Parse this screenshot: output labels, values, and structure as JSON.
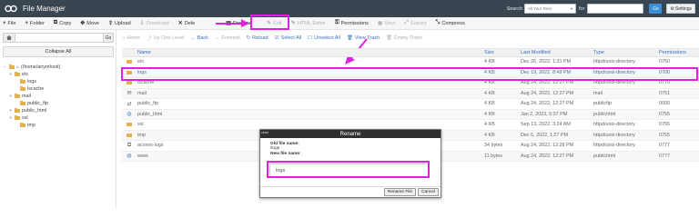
{
  "titlebar": {
    "title": "File Manager",
    "search_label": "Search",
    "search_scope": "All Your Files",
    "for_label": "for",
    "go_label": "Go",
    "settings_label": "Settings"
  },
  "toolbar": {
    "items": [
      {
        "label": "File",
        "icon": "plus-icon"
      },
      {
        "label": "Folder",
        "icon": "plus-icon"
      },
      {
        "label": "Copy",
        "icon": "copy-icon"
      },
      {
        "label": "Move",
        "icon": "move-icon"
      },
      {
        "label": "Upload",
        "icon": "upload-icon"
      },
      {
        "label": "Download",
        "icon": "download-icon"
      },
      {
        "label": "Dele",
        "icon": "close-icon"
      },
      {
        "label": "Rename",
        "icon": "file-icon"
      },
      {
        "label": "Edit",
        "icon": "pencil-icon"
      },
      {
        "label": "HTML Editor",
        "icon": "pencil-icon"
      },
      {
        "label": "Permissions",
        "icon": "key-icon"
      },
      {
        "label": "View",
        "icon": "eye-icon"
      },
      {
        "label": "Extract",
        "icon": "extract-icon"
      },
      {
        "label": "Compress",
        "icon": "compress-icon"
      }
    ]
  },
  "left_pane": {
    "go_label": "Go",
    "collapse_label": "Collapse All",
    "tree": [
      {
        "label": "(/home/anymhost)",
        "level": 0,
        "pm": "−",
        "home": true
      },
      {
        "label": "etc",
        "level": 1,
        "pm": "+"
      },
      {
        "label": "logs",
        "level": 2,
        "pm": ""
      },
      {
        "label": "lscache",
        "level": 2,
        "pm": ""
      },
      {
        "label": "mail",
        "level": 1,
        "pm": "+"
      },
      {
        "label": "public_ftp",
        "level": 2,
        "pm": ""
      },
      {
        "label": "public_html",
        "level": 1,
        "pm": "+"
      },
      {
        "label": "ssl",
        "level": 1,
        "pm": "+"
      },
      {
        "label": "tmp",
        "level": 2,
        "pm": ""
      }
    ]
  },
  "actionbar": {
    "items": [
      {
        "label": "Home",
        "icon": "home-icon"
      },
      {
        "label": "Up One Level",
        "icon": "up-icon"
      },
      {
        "label": "Back",
        "icon": "back-icon"
      },
      {
        "label": "Forward",
        "icon": "forward-icon"
      },
      {
        "label": "Reload",
        "icon": "reload-icon"
      },
      {
        "label": "Select All",
        "icon": "check-icon"
      },
      {
        "label": "Unselect All",
        "icon": "uncheck-icon"
      },
      {
        "label": "View Trash",
        "icon": "trash-icon"
      },
      {
        "label": "Empty Trash",
        "icon": "trash-icon"
      }
    ]
  },
  "table": {
    "headers": [
      "Name",
      "Size",
      "Last Modified",
      "Type",
      "Permissions"
    ],
    "rows": [
      {
        "name": "etc",
        "size": "4 KB",
        "modified": "Dec 26, 2022, 1:31 PM",
        "type": "httpd/unix-directory",
        "perm": "0750",
        "icon": "folder"
      },
      {
        "name": "logs",
        "size": "4 KB",
        "modified": "Dec 19, 2022, 8:49 PM",
        "type": "httpd/unix-directory",
        "perm": "0700",
        "icon": "folder"
      },
      {
        "name": "lscache",
        "size": "4 KB",
        "modified": "Aug 24, 2022, 12:27 PM",
        "type": "httpd/unix-directory",
        "perm": "0770",
        "icon": "folder"
      },
      {
        "name": "mail",
        "size": "4 KB",
        "modified": "Aug 24, 2022, 12:27 PM",
        "type": "mail",
        "perm": "0751",
        "icon": "mail"
      },
      {
        "name": "public_ftp",
        "size": "4 KB",
        "modified": "Aug 24, 2022, 12:27 PM",
        "type": "publicftp",
        "perm": "0000",
        "icon": "ftp"
      },
      {
        "name": "public_html",
        "size": "4 KB",
        "modified": "Jan 2, 2023, 5:37 PM",
        "type": "publichtml",
        "perm": "0755",
        "icon": "globe"
      },
      {
        "name": "ssl",
        "size": "4 KB",
        "modified": "Sep 13, 2022, 3:24 AM",
        "type": "httpd/unix-directory",
        "perm": "0755",
        "icon": "folder"
      },
      {
        "name": "tmp",
        "size": "4 KB",
        "modified": "Dec 6, 2022, 1:27 PM",
        "type": "httpd/unix-directory",
        "perm": "0755",
        "icon": "folder"
      },
      {
        "name": "access-logs",
        "size": "34 bytes",
        "modified": "Aug 24, 2022, 12:28 PM",
        "type": "httpd/unix-directory",
        "perm": "0777",
        "icon": "link"
      },
      {
        "name": "www",
        "size": "11 bytes",
        "modified": "Aug 24, 2022, 12:27 PM",
        "type": "publichtml",
        "perm": "0777",
        "icon": "globe"
      }
    ]
  },
  "dialog": {
    "title": "Rename",
    "close_label": "close",
    "old_label": "Old file name:",
    "old_value": "/logs",
    "new_label": "New file name:",
    "new_value": "logs",
    "rename_label": "Rename File",
    "cancel_label": "Cancel"
  },
  "colors": {
    "titlebar": "#3a4552",
    "highlight": "#e020e0",
    "link": "#3b6eb3"
  }
}
